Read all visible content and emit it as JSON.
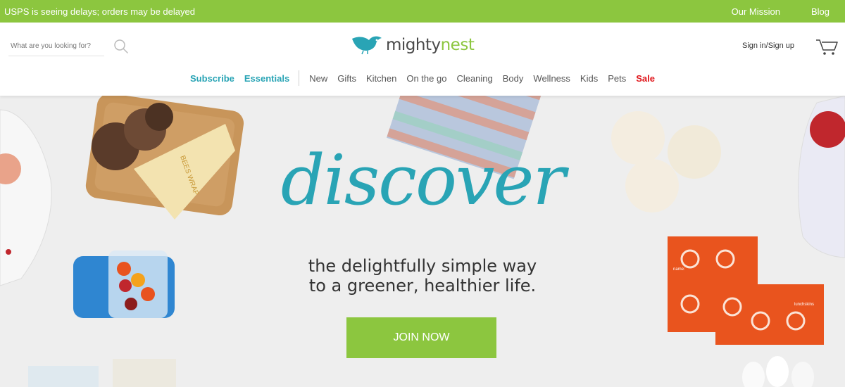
{
  "announcement": {
    "message": "USPS is seeing delays; orders may be delayed",
    "links": [
      "Our Mission",
      "Blog"
    ]
  },
  "header": {
    "search_placeholder": "What are you looking for?",
    "logo_text_1": "mighty",
    "logo_text_2": "nest",
    "signin": "Sign in/Sign up"
  },
  "nav": {
    "subscribe": "Subscribe",
    "essentials": "Essentials",
    "items": [
      "New",
      "Gifts",
      "Kitchen",
      "On the go",
      "Cleaning",
      "Body",
      "Wellness",
      "Kids",
      "Pets"
    ],
    "sale": "Sale"
  },
  "hero": {
    "headline": "discover",
    "tagline_line1": "the delightfully simple way",
    "tagline_line2": "to a greener, healthier life.",
    "cta": "JOIN NOW",
    "product_labels": {
      "wrap": "BEES WRAP",
      "lunchskins": "lunchskins",
      "name_label": "name:"
    }
  },
  "colors": {
    "brand_green": "#8cc63f",
    "brand_teal": "#29a4b5",
    "sale_red": "#e0161b",
    "hero_bg": "#eeeeee"
  },
  "icons": [
    "search-icon",
    "bird-logo-icon",
    "cart-icon"
  ]
}
